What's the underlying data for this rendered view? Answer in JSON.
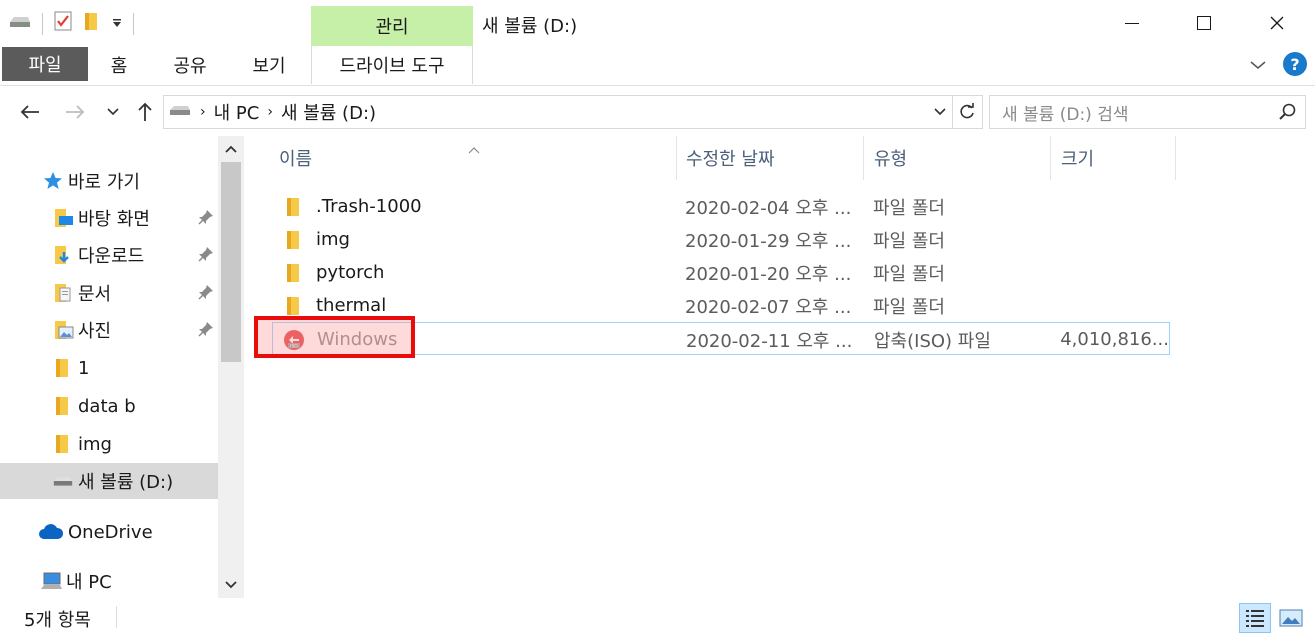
{
  "window": {
    "title": "새 볼륨 (D:)",
    "manage_tab": "관리"
  },
  "ribbon": {
    "tabs": [
      {
        "label": "파일"
      },
      {
        "label": "홈"
      },
      {
        "label": "공유"
      },
      {
        "label": "보기"
      },
      {
        "label": "드라이브 도구"
      }
    ]
  },
  "address": {
    "crumbs": [
      "내 PC",
      "새 볼륨 (D:)"
    ],
    "search_placeholder": "새 볼륨 (D:) 검색"
  },
  "nav": {
    "quick_access": "바로 가기",
    "items": [
      {
        "label": "바탕 화면",
        "icon": "desktop-folder-icon",
        "pinned": true
      },
      {
        "label": "다운로드",
        "icon": "downloads-folder-icon",
        "pinned": true
      },
      {
        "label": "문서",
        "icon": "documents-folder-icon",
        "pinned": true
      },
      {
        "label": "사진",
        "icon": "pictures-folder-icon",
        "pinned": true
      },
      {
        "label": "1",
        "icon": "folder-icon",
        "pinned": false
      },
      {
        "label": "data b",
        "icon": "folder-icon",
        "pinned": false
      },
      {
        "label": "img",
        "icon": "folder-icon",
        "pinned": false
      },
      {
        "label": "새 볼륨 (D:)",
        "icon": "drive-icon",
        "pinned": false,
        "selected": true
      }
    ],
    "onedrive": "OneDrive",
    "this_pc": "내 PC"
  },
  "columns": {
    "name": "이름",
    "date": "수정한 날짜",
    "type": "유형",
    "size": "크기"
  },
  "files": [
    {
      "name": ".Trash-1000",
      "date": "2020-02-04 오후 ...",
      "type": "파일 폴더",
      "size": "",
      "icon": "folder-icon"
    },
    {
      "name": "img",
      "date": "2020-01-29 오후 ...",
      "type": "파일 폴더",
      "size": "",
      "icon": "folder-icon"
    },
    {
      "name": "pytorch",
      "date": "2020-01-20 오후 ...",
      "type": "파일 폴더",
      "size": "",
      "icon": "folder-icon"
    },
    {
      "name": "thermal",
      "date": "2020-02-07 오후 ...",
      "type": "파일 폴더",
      "size": "",
      "icon": "folder-icon"
    },
    {
      "name": "Windows",
      "date": "2020-02-11 오후 ...",
      "type": "압축(ISO) 파일",
      "size": "4,010,816...",
      "icon": "iso-file-icon",
      "selected": true
    }
  ],
  "status": {
    "count": "5개 항목"
  },
  "colors": {
    "manage_tab_bg": "#c6efa7",
    "file_tab_bg": "#5b5b5b",
    "highlight_border": "#ea0b0b",
    "help_bg": "#1979ca"
  }
}
